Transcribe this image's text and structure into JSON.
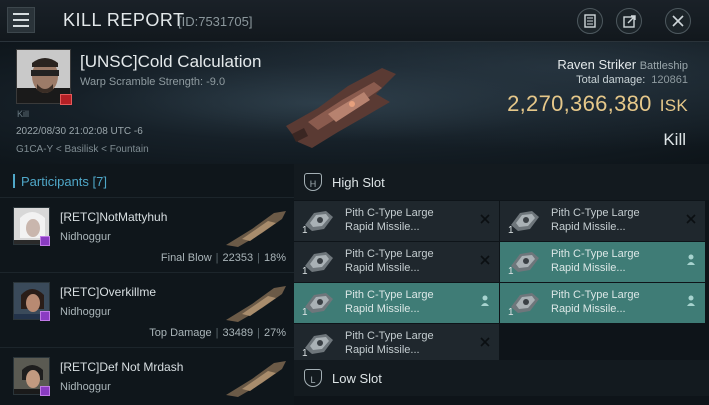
{
  "header": {
    "title": "KILL REPORT",
    "id_label": "[ID:7531705]"
  },
  "victim": {
    "name": "[UNSC]Cold Calculation",
    "warp_scramble": "Warp Scramble Strength: -9.0",
    "kill_small": "Kill",
    "datetime": "2022/08/30 21:02:08 UTC -6",
    "location": "G1CA-Y < Basilisk < Fountain",
    "ship_name": "Raven Striker",
    "ship_class": "Battleship",
    "total_damage_label": "Total damage:",
    "total_damage_value": "120861",
    "isk_value": "2,270,366,380",
    "isk_unit": "ISK",
    "result": "Kill"
  },
  "participants": {
    "title": "Participants [7]",
    "rows": [
      {
        "name": "[RETC]NotMattyhuh",
        "ship": "Nidhoggur",
        "role": "Final Blow",
        "damage": "22353",
        "percent": "18%"
      },
      {
        "name": "[RETC]Overkillme",
        "ship": "Nidhoggur",
        "role": "Top Damage",
        "damage": "33489",
        "percent": "27%"
      },
      {
        "name": "[RETC]Def Not Mrdash",
        "ship": "Nidhoggur",
        "role": "",
        "damage": "",
        "percent": ""
      }
    ]
  },
  "slots": {
    "high_label": "High Slot",
    "low_label": "Low Slot",
    "high_items": [
      {
        "name": "Pith C-Type Large Rapid Missile...",
        "qty": "1",
        "status": "destroyed"
      },
      {
        "name": "Pith C-Type Large Rapid Missile...",
        "qty": "1",
        "status": "destroyed"
      },
      {
        "name": "Pith C-Type Large Rapid Missile...",
        "qty": "1",
        "status": "destroyed"
      },
      {
        "name": "Pith C-Type Large Rapid Missile...",
        "qty": "1",
        "status": "dropped"
      },
      {
        "name": "Pith C-Type Large Rapid Missile...",
        "qty": "1",
        "status": "dropped"
      },
      {
        "name": "Pith C-Type Large Rapid Missile...",
        "qty": "1",
        "status": "dropped"
      },
      {
        "name": "Pith C-Type Large Rapid Missile...",
        "qty": "1",
        "status": "destroyed"
      }
    ]
  },
  "colors": {
    "accent": "#4fa7c8",
    "isk": "#e6c88a",
    "dropped": "#3f7c76",
    "destroyed": "#1f272d"
  }
}
